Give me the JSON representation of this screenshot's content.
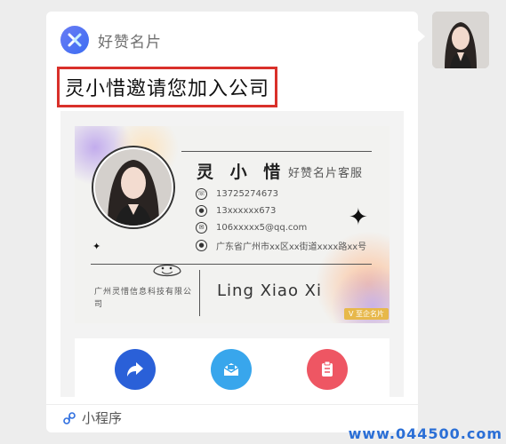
{
  "app": {
    "name": "好赞名片",
    "logo_icon": "app-logo-icon"
  },
  "message": {
    "invite_title": "灵小惜邀请您加入公司",
    "highlight_color": "#d9302a"
  },
  "business_card": {
    "name": "灵 小 惜",
    "role": "好赞名片客服",
    "phone": "13725274673",
    "wechat": "13xxxxxx673",
    "email": "106xxxxx5@qq.com",
    "address": "广东省广州市xx区xx街道xxxx路xx号",
    "company": "广州灵惜信息科技有限公司",
    "pinyin_name": "Ling Xiao Xi",
    "badge": "V 至企名片"
  },
  "actions": [
    {
      "name": "share",
      "icon": "share-arrow-icon",
      "color": "#2a60d8"
    },
    {
      "name": "mail",
      "icon": "envelope-icon",
      "color": "#38a6ec"
    },
    {
      "name": "save",
      "icon": "clipboard-icon",
      "color": "#ee5663"
    }
  ],
  "footer": {
    "label": "小程序",
    "icon": "mini-program-icon"
  },
  "watermark": "www.044500.com"
}
